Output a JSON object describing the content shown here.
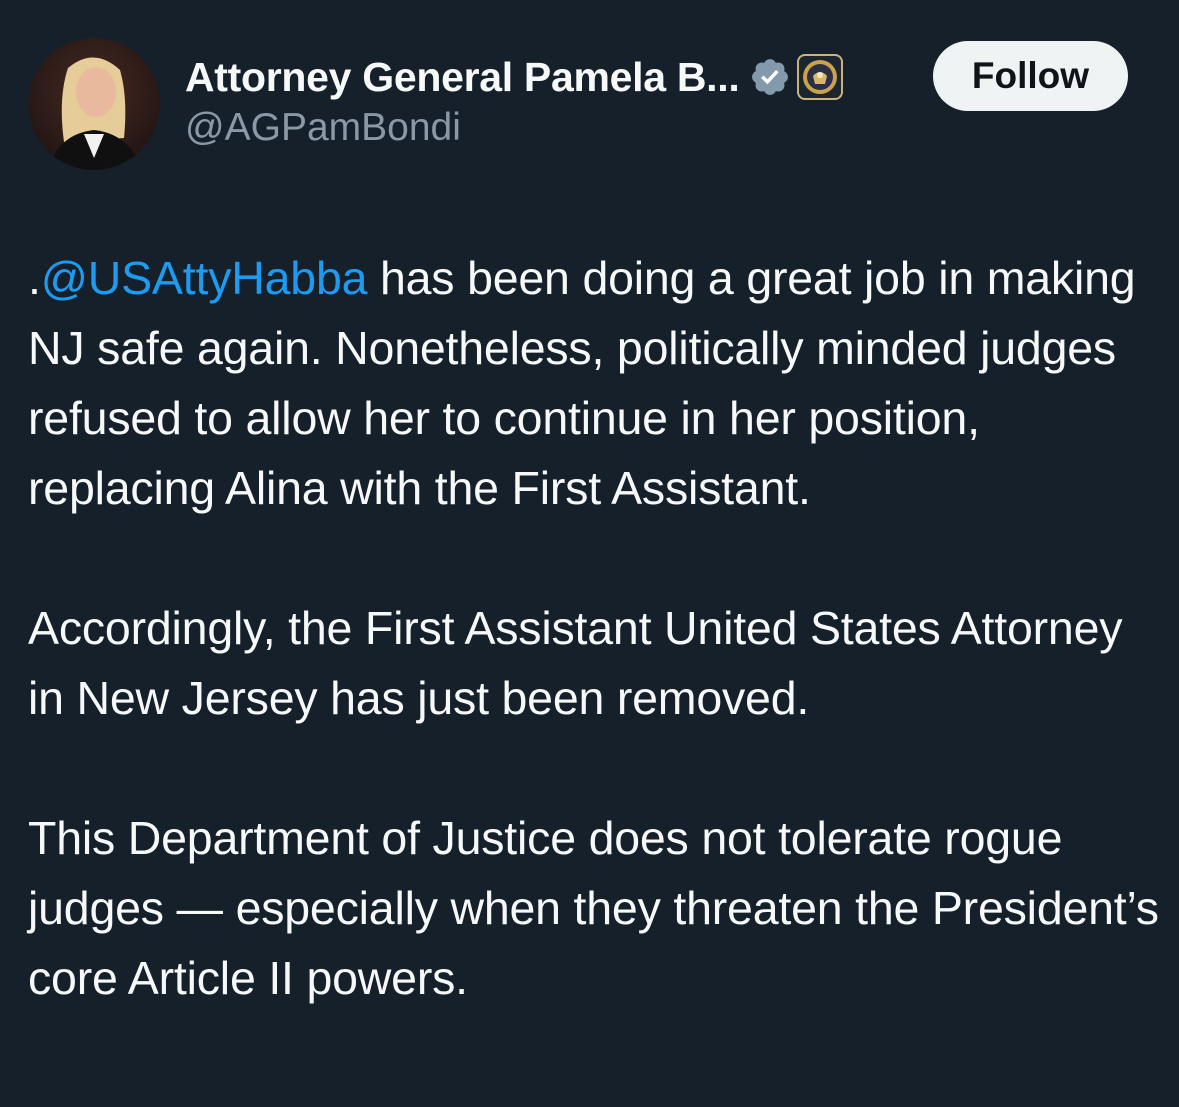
{
  "author": {
    "display_name": "Attorney General Pamela B...",
    "handle": "@AGPamBondi",
    "verified_icon": "verified-badge-icon",
    "affiliation_icon": "doj-seal-icon"
  },
  "actions": {
    "follow_label": "Follow"
  },
  "tweet": {
    "paragraph1": {
      "prefix": ".",
      "mention": "@USAttyHabba",
      "text": " has been doing a great job in making NJ safe again. Nonetheless, politically minded judges refused to allow her to continue in her position, replacing Alina with the First Assistant."
    },
    "paragraph2": "Accordingly, the First Assistant United States Attorney in New Jersey has just been removed.",
    "paragraph3": "This Department of Justice does not tolerate rogue judges — especially when they threaten the President’s core Article II powers."
  },
  "colors": {
    "background": "#15202b",
    "text": "#f7f9f9",
    "secondary_text": "#8b98a5",
    "link": "#1d9bf0",
    "follow_bg": "#eff3f4",
    "verified": "#829aab"
  }
}
